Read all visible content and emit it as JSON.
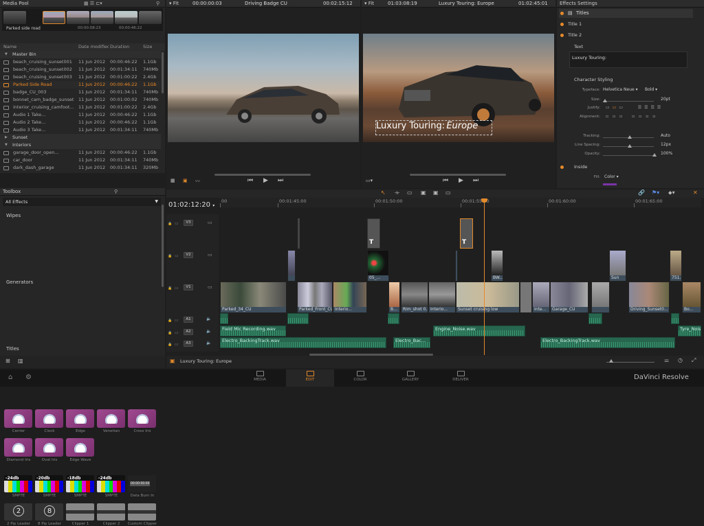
{
  "media_pool": {
    "title": "Media Pool",
    "selected_clip": "Parked side road",
    "tc_in": "00:00:08:23",
    "tc_out": "00:00:46:22",
    "columns": [
      "Name",
      "Date modified",
      "Duration",
      "Size"
    ],
    "rows": [
      {
        "type": "bin",
        "name": "Master Bin",
        "open": true
      },
      {
        "type": "clip",
        "name": "beach_cruising_sunset001",
        "date": "11 Jun 2012",
        "dur": "00:00:46:22",
        "size": "1.1Gb"
      },
      {
        "type": "clip",
        "name": "beach_cruising_sunset002",
        "date": "11 Jun 2012",
        "dur": "00:01:34:11",
        "size": "740Mb"
      },
      {
        "type": "clip",
        "name": "beach_cruising_sunset003",
        "date": "11 Jun 2012",
        "dur": "00:01:00:22",
        "size": "2.4Gb"
      },
      {
        "type": "clip",
        "name": "Parked Side Road",
        "date": "11 Jun 2012",
        "dur": "00:00:46:22",
        "size": "1.1Gb",
        "selected": true
      },
      {
        "type": "clip",
        "name": "badge_CU_003",
        "date": "11 Jun 2012",
        "dur": "00:01:34:11",
        "size": "740Mb"
      },
      {
        "type": "clip",
        "name": "bonnet_cam_badge_sunset",
        "date": "11 Jun 2012",
        "dur": "00:01:00:02",
        "size": "740Mb"
      },
      {
        "type": "clip",
        "name": "interior_cruising_camfoot...",
        "date": "11 Jun 2012",
        "dur": "00:01:00:22",
        "size": "2.4Gb"
      },
      {
        "type": "clip",
        "name": "Audio 1 Take...",
        "date": "11 Jun 2012",
        "dur": "00:00:46:22",
        "size": "1.1Gb"
      },
      {
        "type": "clip",
        "name": "Audio 2 Take...",
        "date": "11 Jun 2012",
        "dur": "00:00:46:22",
        "size": "1.1Gb"
      },
      {
        "type": "clip",
        "name": "Audio 3 Take...",
        "date": "11 Jun 2012",
        "dur": "00:01:34:11",
        "size": "740Mb"
      },
      {
        "type": "bin",
        "name": "Sunset",
        "open": false
      },
      {
        "type": "bin",
        "name": "Interiors",
        "open": true
      },
      {
        "type": "clip",
        "name": "garage_door_open...",
        "date": "11 Jun 2012",
        "dur": "00:00:46:22",
        "size": "1.1Gb"
      },
      {
        "type": "clip",
        "name": "car_door",
        "date": "11 Jun 2012",
        "dur": "00:01:34:11",
        "size": "740Mb"
      },
      {
        "type": "clip",
        "name": "dark_dash_garage",
        "date": "11 Jun 2012",
        "dur": "00:01:34:11",
        "size": "320Mb"
      }
    ]
  },
  "toolbox": {
    "title": "Toolbox",
    "filter": "All Effects",
    "wipes_label": "Wipes",
    "wipes": [
      "Center",
      "Clock",
      "Edge",
      "Venetian",
      "Cross Iris",
      "Diamond Iris",
      "Oval Iris",
      "Edge Wave"
    ],
    "generators_label": "Generators",
    "generators": [
      {
        "label": "SMPTE",
        "badge": "-24db"
      },
      {
        "label": "SMPTE",
        "badge": "-20db"
      },
      {
        "label": "SMPTE",
        "badge": "-18db"
      },
      {
        "label": "SMPTE",
        "badge": "-24db"
      },
      {
        "label": "Data Burn In",
        "badge": "00:00:00:00"
      },
      {
        "label": "2 Pip Leader",
        "badge": "2"
      },
      {
        "label": "8 Pip Leader",
        "badge": "8"
      },
      {
        "label": "Clipper 1",
        "badge": ""
      },
      {
        "label": "Clipper 2",
        "badge": ""
      },
      {
        "label": "Custom Clipper",
        "badge": ""
      }
    ],
    "titles_label": "Titles"
  },
  "source_viewer": {
    "zoom": "Fit",
    "tc_left": "00:00:00:03",
    "clip_name": "Driving Badge CU",
    "tc_right": "00:02:15:12"
  },
  "timeline_viewer": {
    "zoom": "Fit",
    "tc_left": "01:03:08:19",
    "clip_name": "Luxury Touring: Europe",
    "tc_right": "01:02:45:01",
    "overlay_main": "Luxury Touring:",
    "overlay_italic": "Europe"
  },
  "effects_settings": {
    "title": "Effects Settings",
    "tree": [
      "Titles",
      "Title 1",
      "Title 2"
    ],
    "text_section": "Text",
    "text_value": "Luxury Touring:",
    "char_section": "Character Styling",
    "typeface_label": "Typeface:",
    "typeface": "Helvetica Neue",
    "weight": "Bold",
    "size_label": "Size:",
    "size": "20pt",
    "justify_label": "Justify:",
    "align_label": "Alignment:",
    "tracking_label": "Tracking:",
    "tracking": "Auto",
    "line_spacing_label": "Line Spacing:",
    "line_spacing": "12px",
    "opacity_label": "Opacity:",
    "opacity": "100%",
    "inside_section": "Inside",
    "fill_label": "Fill:",
    "fill": "Color"
  },
  "timeline": {
    "timecode": "01:02:12:20",
    "ruler": [
      {
        "label": "00",
        "pos": 0
      },
      {
        "label": "00:01:45:00",
        "pos": 0.12
      },
      {
        "label": "00:01:50:00",
        "pos": 0.32
      },
      {
        "label": "00:01:55:00",
        "pos": 0.5
      },
      {
        "label": "00:01:60:00",
        "pos": 0.68
      },
      {
        "label": "00:01:65:00",
        "pos": 0.86
      }
    ],
    "tracks": [
      "V3",
      "V2",
      "V1",
      "A1",
      "A2",
      "A3"
    ],
    "v1_clips": [
      "Parked_34_CU",
      "Parked_Front_CU",
      "Interio...",
      "B...",
      "Rim_shot 0...",
      "Interio...",
      "Sunset cruising low",
      "Inte...",
      "Garage_CU",
      "Driving_Sunset0...",
      "Bo..."
    ],
    "v2_clips": [
      "05_...",
      "BW...",
      "Sun",
      "751..."
    ],
    "a1_clips": [],
    "a2_clips": [
      "Field Mic Recording.wav",
      "Engine_Noise.wav",
      "Tyre_Nois..."
    ],
    "a3_clips": [
      "Electro_BackingTrack.wav",
      "Electro_Bac...",
      "Electro_BackingTrack.wav"
    ],
    "bottom_label": "Luxury Touring: Europe"
  },
  "pages": [
    "MEDIA",
    "EDIT",
    "COLOR",
    "GALLERY",
    "DELIVER"
  ],
  "active_page": "EDIT",
  "brand": "DaVinci Resolve",
  "colors": {
    "accent": "#e48a2b",
    "audio": "#27664f",
    "video": "#3d4d5c",
    "wipe": "#8e3d7e"
  }
}
